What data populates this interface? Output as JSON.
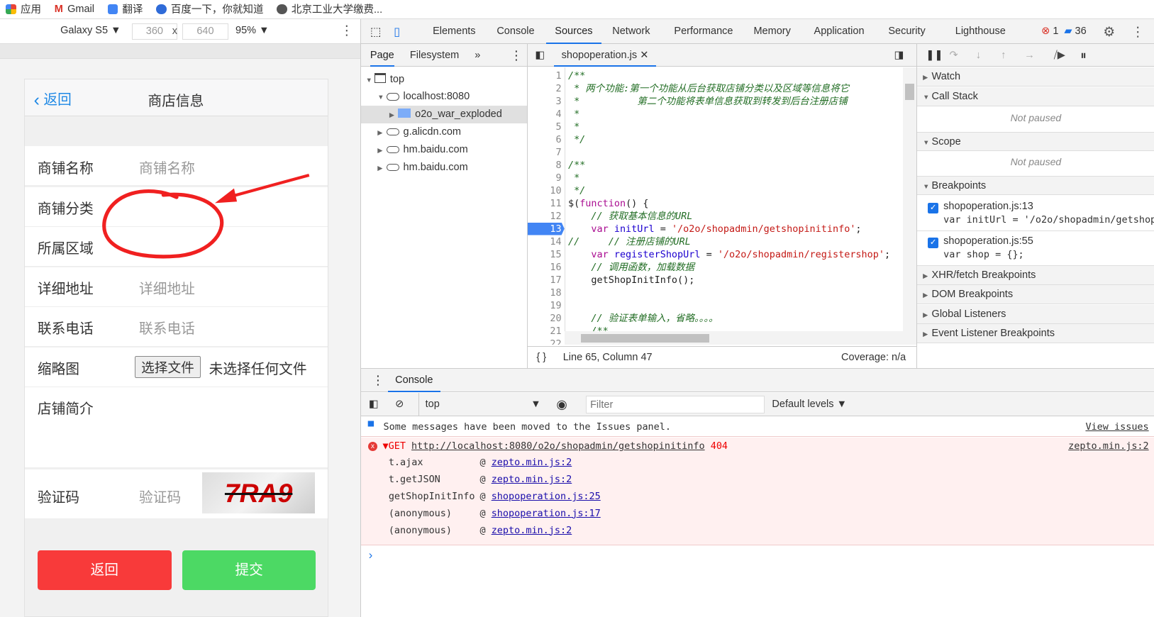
{
  "bookmarks": [
    {
      "label": "应用",
      "icon": "apps-icon"
    },
    {
      "label": "Gmail",
      "icon": "gmail-icon"
    },
    {
      "label": "翻译",
      "icon": "translate-icon"
    },
    {
      "label": "百度一下，你就知道",
      "icon": "baidu-icon"
    },
    {
      "label": "北京工业大学缴费...",
      "icon": "globe-icon"
    }
  ],
  "device": {
    "name": "Galaxy S5",
    "width": "360",
    "height": "640",
    "x": "x",
    "zoom": "95%"
  },
  "phone": {
    "back": "返回",
    "title": "商店信息",
    "fields": [
      {
        "label": "商铺名称",
        "placeholder": "商铺名称"
      },
      {
        "label": "商铺分类",
        "placeholder": ""
      },
      {
        "label": "所属区域",
        "placeholder": ""
      },
      {
        "label": "详细地址",
        "placeholder": "详细地址"
      },
      {
        "label": "联系电话",
        "placeholder": "联系电话"
      }
    ],
    "thumb_label": "缩略图",
    "choose_file": "选择文件",
    "no_file": "未选择任何文件",
    "intro_label": "店铺简介",
    "captcha_label": "验证码",
    "captcha_placeholder": "验证码",
    "captcha_text": "7RA9",
    "back_button": "返回",
    "submit_button": "提交",
    "back_color": "#f83a3a",
    "submit_color": "#4cd964"
  },
  "devtools": {
    "tabs": [
      "Elements",
      "Console",
      "Sources",
      "Network",
      "Performance",
      "Memory",
      "Application",
      "Security",
      "Lighthouse"
    ],
    "active_tab": "Sources",
    "errors": "1",
    "issues": "36",
    "navigator": {
      "tabs": [
        "Page",
        "Filesystem"
      ],
      "more": "»",
      "tree": [
        {
          "label": "top",
          "level": 0,
          "icon": "frame-icon",
          "open": true
        },
        {
          "label": "localhost:8080",
          "level": 1,
          "icon": "cloud-icon",
          "open": true
        },
        {
          "label": "o2o_war_exploded",
          "level": 2,
          "icon": "folder-icon",
          "open": false,
          "selected": true
        },
        {
          "label": "g.alicdn.com",
          "level": 1,
          "icon": "cloud-icon",
          "open": false
        },
        {
          "label": "hm.baidu.com",
          "level": 1,
          "icon": "cloud-icon",
          "open": false
        },
        {
          "label": "hm.baidu.com",
          "level": 1,
          "icon": "cloud-icon",
          "open": false
        }
      ]
    },
    "editor": {
      "file": "shopoperation.js",
      "breakpoint_line": 13,
      "status": "Line 65, Column 47",
      "coverage": "Coverage: n/a",
      "lines": [
        [
          [
            "c",
            "/**"
          ]
        ],
        [
          [
            "c",
            " * 两个功能:第一个功能从后台获取店铺分类以及区域等信息将它"
          ]
        ],
        [
          [
            "c",
            " *          第二个功能将表单信息获取到转发到后台注册店铺"
          ]
        ],
        [
          [
            "c",
            " *"
          ]
        ],
        [
          [
            "c",
            " *"
          ]
        ],
        [
          [
            "c",
            " */"
          ]
        ],
        [],
        [
          [
            "c",
            "/**"
          ]
        ],
        [
          [
            "c",
            " *"
          ]
        ],
        [
          [
            "c",
            " */"
          ]
        ],
        [
          [
            "p",
            "$("
          ],
          [
            "k",
            "function"
          ],
          [
            "p",
            "() {"
          ]
        ],
        [
          [
            "p",
            "    "
          ],
          [
            "c",
            "// 获取基本信息的URL"
          ]
        ],
        [
          [
            "p",
            "    "
          ],
          [
            "k",
            "var"
          ],
          [
            "p",
            " "
          ],
          [
            "v",
            "initUrl"
          ],
          [
            "p",
            " = "
          ],
          [
            "s",
            "'/o2o/shopadmin/getshopinitinfo'"
          ],
          [
            "p",
            ";"
          ]
        ],
        [
          [
            "c",
            "//     // 注册店铺的URL"
          ]
        ],
        [
          [
            "p",
            "    "
          ],
          [
            "k",
            "var"
          ],
          [
            "p",
            " "
          ],
          [
            "v",
            "registerShopUrl"
          ],
          [
            "p",
            " = "
          ],
          [
            "s",
            "'/o2o/shopadmin/registershop'"
          ],
          [
            "p",
            ";"
          ]
        ],
        [
          [
            "p",
            "    "
          ],
          [
            "c",
            "// 调用函数，加载数据"
          ]
        ],
        [
          [
            "p",
            "    getShopInitInfo();"
          ]
        ],
        [],
        [],
        [
          [
            "p",
            "    "
          ],
          [
            "c",
            "// 验证表单输入，省略。。。。"
          ]
        ],
        [
          [
            "p",
            "    "
          ],
          [
            "c",
            "/**"
          ]
        ],
        []
      ]
    },
    "debugger": {
      "watch": "Watch",
      "call_stack": "Call Stack",
      "not_paused": "Not paused",
      "scope": "Scope",
      "breakpoints": "Breakpoints",
      "bp_items": [
        {
          "file": "shopoperation.js:13",
          "code": "var initUrl = '/o2o/shopadmin/getshopinitinfo';"
        },
        {
          "file": "shopoperation.js:55",
          "code": "var shop = {};"
        }
      ],
      "more_sections": [
        "XHR/fetch Breakpoints",
        "DOM Breakpoints",
        "Global Listeners",
        "Event Listener Breakpoints"
      ]
    },
    "console": {
      "tab": "Console",
      "context": "top",
      "filter_placeholder": "Filter",
      "levels": "Default levels",
      "info": "Some messages have been moved to the Issues panel.",
      "view_issues": "View issues",
      "error": {
        "method": "GET",
        "url": "http://localhost:8080/o2o/shopadmin/getshopinitinfo",
        "status": "404",
        "source": "zepto.min.js:2"
      },
      "stack": [
        {
          "fn": "t.ajax",
          "src": "zepto.min.js:2"
        },
        {
          "fn": "t.getJSON",
          "src": "zepto.min.js:2"
        },
        {
          "fn": "getShopInitInfo",
          "src": "shopoperation.js:25"
        },
        {
          "fn": "(anonymous)",
          "src": "shopoperation.js:17"
        },
        {
          "fn": "(anonymous)",
          "src": "zepto.min.js:2"
        }
      ],
      "prompt": "›"
    }
  },
  "annotation_color": "#f02020"
}
